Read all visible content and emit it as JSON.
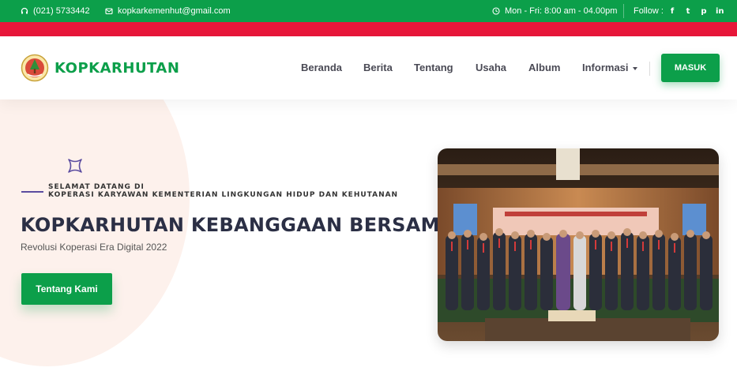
{
  "topbar": {
    "phone": "(021) 5733442",
    "email": "kopkarkemenhut@gmail.com",
    "hours": "Mon - Fri: 8:00 am - 04.00pm",
    "follow_label": "Follow :",
    "social": [
      {
        "icon": "facebook-icon",
        "glyph": "f"
      },
      {
        "icon": "twitter-icon",
        "glyph": "t"
      },
      {
        "icon": "pinterest-icon",
        "glyph": "p"
      },
      {
        "icon": "linkedin-icon",
        "glyph": "in"
      }
    ]
  },
  "nav": {
    "brand": "KOPKARHUTAN",
    "items": [
      "Beranda",
      "Berita",
      "Tentang",
      "Usaha",
      "Album",
      "Informasi"
    ],
    "login_label": "MASUK"
  },
  "hero": {
    "welcome_line1": "SELAMAT DATANG DI",
    "welcome_line2": "KOPERASI KARYAWAN KEMENTERIAN LINGKUNGAN HIDUP DAN KEHUTANAN",
    "headline": "KOPKARHUTAN KEBANGGAAN BERSAMA",
    "subtitle": "Revolusi Koperasi Era Digital 2022",
    "cta_label": "Tentang Kami"
  },
  "colors": {
    "primary_green": "#0c9f4a",
    "accent_red": "#e8173a",
    "heading": "#2b2f45",
    "accent_purple": "#5b4ca0"
  }
}
